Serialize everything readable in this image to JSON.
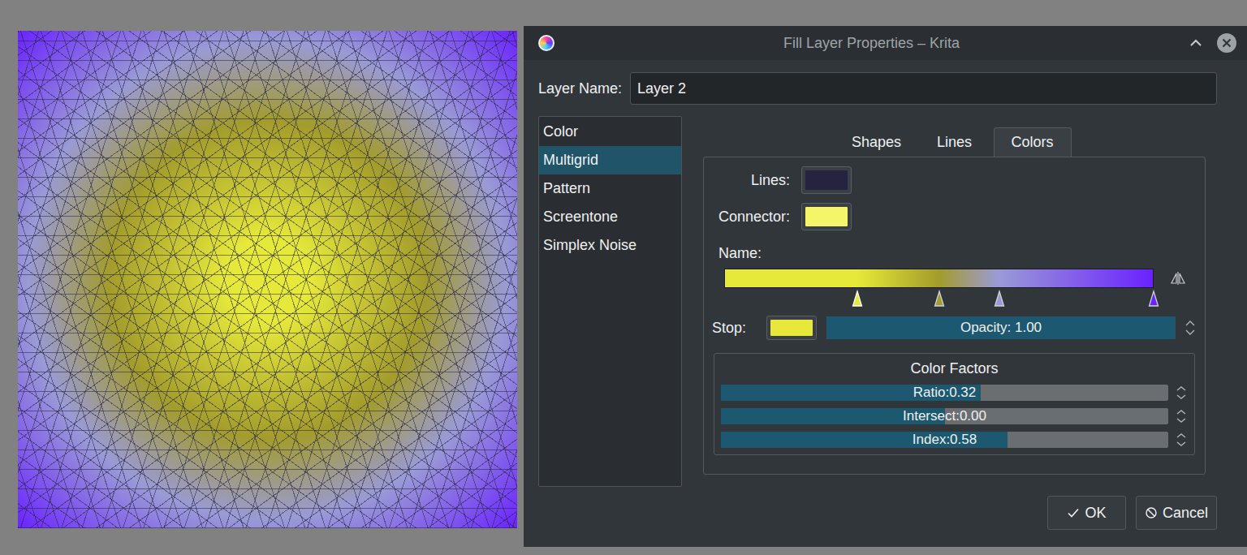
{
  "window": {
    "title": "Fill Layer Properties – Krita"
  },
  "layer_name": {
    "label": "Layer Name:",
    "value": "Layer 2"
  },
  "sidebar": {
    "items": [
      {
        "label": "Color",
        "selected": false
      },
      {
        "label": "Multigrid",
        "selected": true
      },
      {
        "label": "Pattern",
        "selected": false
      },
      {
        "label": "Screentone",
        "selected": false
      },
      {
        "label": "Simplex Noise",
        "selected": false
      }
    ]
  },
  "tabs": [
    {
      "label": "Shapes",
      "selected": false
    },
    {
      "label": "Lines",
      "selected": false
    },
    {
      "label": "Colors",
      "selected": true
    }
  ],
  "swatches": [
    {
      "label": "Lines:",
      "color": "#25233f"
    },
    {
      "label": "Connector:",
      "color": "#f5f56a"
    }
  ],
  "gradient": {
    "label": "Name:",
    "stops": [
      {
        "position": 0.31,
        "color": "#e6e83a",
        "selected": true
      },
      {
        "position": 0.5,
        "color": "#a39c2c",
        "selected": false
      },
      {
        "position": 0.64,
        "color": "#9a9ad6",
        "selected": false
      },
      {
        "position": 1,
        "color": "#6a22ff",
        "selected": false
      }
    ]
  },
  "stop": {
    "label": "Stop:",
    "color": "#e6e83a",
    "opacity": {
      "reading": "Opacity: 1.00",
      "level": 1
    }
  },
  "factors": {
    "title": "Color Factors",
    "sliders": [
      {
        "reading": "Ratio:0.32",
        "level": 0.58
      },
      {
        "reading": "Intersect:0.00",
        "level": 0.5
      },
      {
        "reading": "Index:0.58",
        "level": 0.64
      }
    ]
  },
  "buttons": [
    {
      "label": "OK",
      "kind": "ok"
    },
    {
      "label": "Cancel",
      "kind": "cancel"
    }
  ]
}
